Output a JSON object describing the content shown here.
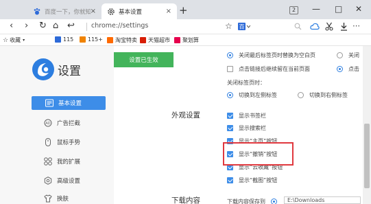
{
  "tabs": [
    {
      "title": "百度一下，你就知道",
      "close": "×"
    },
    {
      "title": "基本设置",
      "close": "×"
    }
  ],
  "newtab": "+",
  "window": {
    "badge": "2",
    "minimize": "—",
    "maximize": "□",
    "close": "✕"
  },
  "nav": {
    "back": "‹",
    "forward": "›",
    "reload": "↻",
    "home": "⌂",
    "undo": "↩",
    "url": "chrome://settings",
    "star": "☆",
    "more": "⋯"
  },
  "bookmarks": [
    {
      "label": "收藏",
      "color": "#f2b400"
    },
    {
      "label": "115",
      "color": "#2d6ad8"
    },
    {
      "label": "115+",
      "color": "#f08300"
    },
    {
      "label": "淘宝特卖",
      "color": "#ff6a00"
    },
    {
      "label": "天猫超市",
      "color": "#d81e06"
    },
    {
      "label": "聚划算",
      "color": "#e6004d"
    }
  ],
  "brand": {
    "title": "设置",
    "color": "#2d7ee0"
  },
  "sidebar": [
    {
      "label": "基本设置",
      "active": true
    },
    {
      "label": "广告拦截"
    },
    {
      "label": "鼠标手势"
    },
    {
      "label": "我的扩展"
    },
    {
      "label": "高级设置"
    },
    {
      "label": "换肤"
    }
  ],
  "settings": {
    "saved_button": "设置已生效",
    "tab_opts": [
      {
        "label": "关闭最后标签页时替换为空白页",
        "checked": true
      },
      {
        "label": "关闭",
        "checked": false
      },
      {
        "label": "点击链接后继续留在当前页面",
        "checked": false
      },
      {
        "label": "点击",
        "checked": true
      }
    ],
    "close_tab_label": "关闭标签页时：",
    "close_tab_opts": [
      {
        "label": "切换到左侧标签",
        "checked": true
      },
      {
        "label": "切换到右侧标签",
        "checked": false
      }
    ],
    "appearance_title": "外观设置",
    "appearance": [
      {
        "label": "显示书签栏",
        "checked": true
      },
      {
        "label": "显示搜索栏",
        "checked": true
      },
      {
        "label": "显示“主页”按钮",
        "checked": true
      },
      {
        "label": "显示“撤销”按钮",
        "checked": true
      },
      {
        "label": "显示“云收藏”按钮",
        "checked": true
      },
      {
        "label": "显示“截图”按钮",
        "checked": true
      }
    ],
    "download_title": "下载内容",
    "download_label": "下载内容保存到",
    "download_path": "E:\\Downloads"
  },
  "colors": {
    "accent": "#3d8de8",
    "green": "#43b45b",
    "highlight": "#e0383e"
  }
}
